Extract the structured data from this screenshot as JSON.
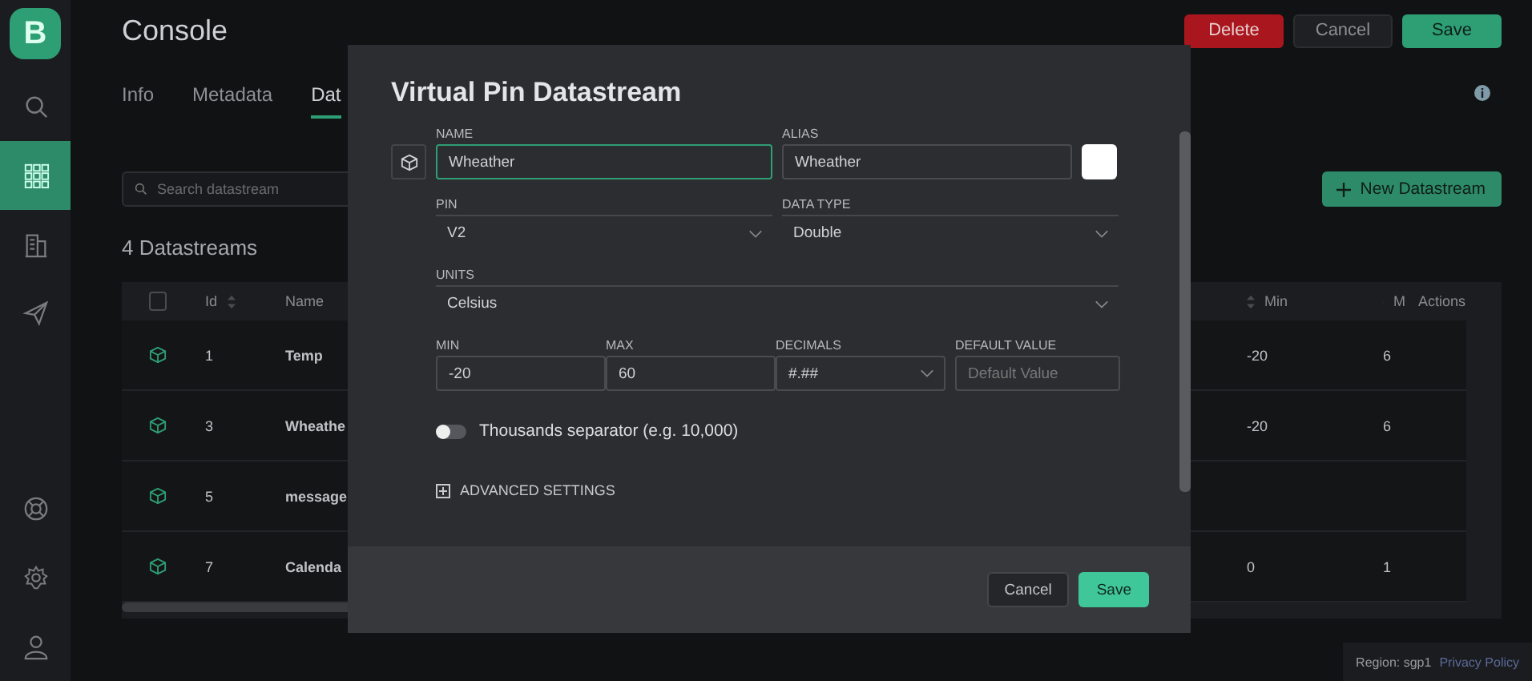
{
  "sidebar": {
    "logo": "B",
    "items": [
      {
        "kind": "search",
        "selected": false
      },
      {
        "kind": "grid",
        "selected": true
      },
      {
        "kind": "building",
        "selected": false
      },
      {
        "kind": "send",
        "selected": false
      },
      {
        "kind": "lifebuoy",
        "selected": false
      },
      {
        "kind": "gear",
        "selected": false
      },
      {
        "kind": "user",
        "selected": false
      }
    ]
  },
  "header": {
    "title": "Console",
    "buttons": [
      {
        "label": "Delete",
        "kind": "danger"
      },
      {
        "label": "Cancel",
        "kind": "secondary"
      },
      {
        "label": "Save",
        "kind": "primary"
      }
    ]
  },
  "tabs": [
    {
      "label": "Info",
      "selected": false
    },
    {
      "label": "Metadata",
      "selected": false
    },
    {
      "label": "Dat",
      "selected": true
    }
  ],
  "search": {
    "placeholder": "Search datastream"
  },
  "new_button": "New Datastream",
  "count_title": "4 Datastreams",
  "table": {
    "select_all_checked": false,
    "columns": [
      "Id",
      "Name",
      "Min",
      "M",
      "Actions"
    ],
    "rows": [
      {
        "id": "1",
        "name": "Temp",
        "min": "-20",
        "max": "6"
      },
      {
        "id": "3",
        "name": "Wheathe",
        "min": "-20",
        "max": "6"
      },
      {
        "id": "5",
        "name": "message"
      },
      {
        "id": "7",
        "name": "Calenda",
        "min": "0",
        "max": "1"
      }
    ]
  },
  "dialog": {
    "title": "Virtual Pin Datastream",
    "name": {
      "label": "NAME",
      "value": "Wheather",
      "focused": true
    },
    "alias": {
      "label": "ALIAS",
      "value": "Wheather"
    },
    "color": "#ffffff",
    "pin": {
      "label": "PIN",
      "value": "V2"
    },
    "data_type": {
      "label": "DATA TYPE",
      "value": "Double"
    },
    "units": {
      "label": "UNITS",
      "value": "Celsius"
    },
    "min": {
      "label": "MIN",
      "value": "-20"
    },
    "max": {
      "label": "MAX",
      "value": "60"
    },
    "decimals": {
      "label": "DECIMALS",
      "value": "#.##"
    },
    "default_value": {
      "label": "DEFAULT VALUE",
      "placeholder": "Default Value"
    },
    "thousands_separator": {
      "label": "Thousands separator (e.g. 10,000)",
      "on": false
    },
    "advanced": "ADVANCED SETTINGS",
    "buttons": [
      {
        "label": "Cancel",
        "kind": "secondary"
      },
      {
        "label": "Save",
        "kind": "primary"
      }
    ]
  },
  "footer": {
    "region": "Region: sgp1",
    "link": "Privacy Policy"
  }
}
